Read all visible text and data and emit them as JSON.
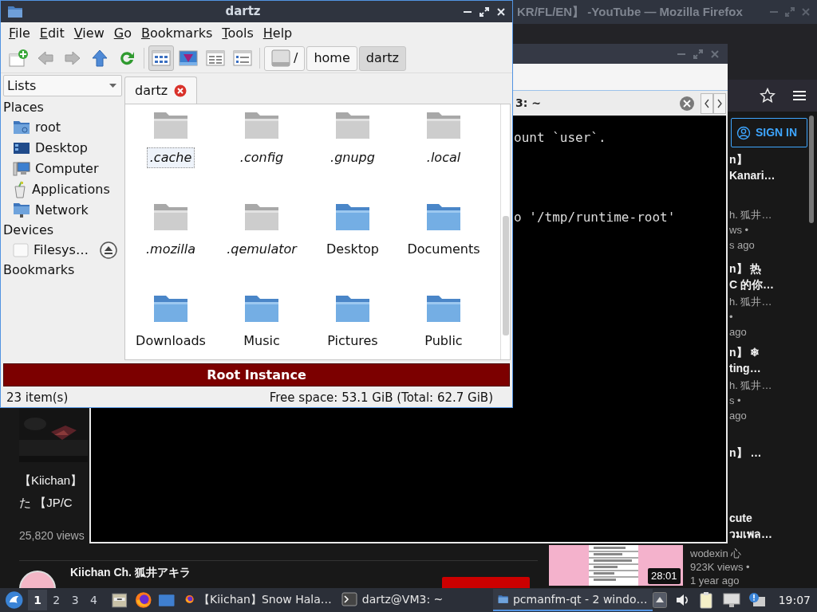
{
  "firefox": {
    "title": "KR/FL/EN】 -YouTube — Mozilla Firefox",
    "sign_in": "SIGN IN",
    "sidebar_videos": [
      {
        "title_lines": [
          "n】",
          "Kanari…"
        ],
        "meta_lines": [
          "h. 狐井…",
          "ws •",
          "s ago"
        ]
      },
      {
        "title_lines": [
          "n】 热",
          "C 的你…"
        ],
        "meta_lines": [
          "h. 狐井…",
          "•",
          "ago"
        ]
      },
      {
        "title_lines": [
          "n】 ❄",
          "ting…"
        ],
        "meta_lines": [
          "h. 狐井…",
          "s •",
          "ago"
        ]
      },
      {
        "title_lines": [
          "n】 …"
        ]
      },
      {
        "title_lines": [
          "cute",
          "วมเพล…"
        ]
      }
    ],
    "main_video": {
      "title_lines": [
        "【Kiichan】",
        "た 【JP/C"
      ],
      "views": "25,820 views",
      "channel": "Kiichan Ch. 狐井アキラ"
    },
    "side_video": {
      "duration": "28:01",
      "channel": "wodexin 心",
      "views": "923K views •",
      "age": "1 year ago"
    }
  },
  "terminal": {
    "tab_title": "3: ~",
    "lines": [
      "ount `user`.",
      "o '/tmp/runtime-root'"
    ]
  },
  "file_manager": {
    "title": "dartz",
    "menu": [
      "File",
      "Edit",
      "View",
      "Go",
      "Bookmarks",
      "Tools",
      "Help"
    ],
    "view_modes": [
      {
        "kind": "icons",
        "selected": true
      },
      {
        "kind": "thumbnails",
        "selected": false
      },
      {
        "kind": "compact",
        "selected": false
      },
      {
        "kind": "details",
        "selected": false
      }
    ],
    "path": [
      {
        "label": "/",
        "kind": "drive",
        "selected": false
      },
      {
        "label": "home",
        "selected": false
      },
      {
        "label": "dartz",
        "selected": true
      }
    ],
    "side_combo": "Lists",
    "sections": [
      {
        "title": "Places",
        "items": [
          {
            "label": "root",
            "kind": "home"
          },
          {
            "label": "Desktop",
            "kind": "desktop"
          },
          {
            "label": "Computer",
            "kind": "computer"
          },
          {
            "label": "Applications",
            "kind": "applications"
          },
          {
            "label": "Network",
            "kind": "network"
          }
        ]
      },
      {
        "title": "Devices",
        "items": [
          {
            "label": "Filesys…",
            "kind": "drive",
            "eject": true
          }
        ]
      },
      {
        "title": "Bookmarks"
      }
    ],
    "tab": "dartz",
    "files": [
      {
        "name": ".cache",
        "hidden": true,
        "selected": true
      },
      {
        "name": ".config",
        "hidden": true,
        "selected": false
      },
      {
        "name": ".gnupg",
        "hidden": true,
        "selected": false
      },
      {
        "name": ".local",
        "hidden": true,
        "selected": false
      },
      {
        "name": ".mozilla",
        "hidden": true,
        "selected": false
      },
      {
        "name": ".qemulator",
        "hidden": true,
        "selected": false
      },
      {
        "name": "Desktop",
        "hidden": false,
        "selected": false
      },
      {
        "name": "Documents",
        "hidden": false,
        "selected": false
      },
      {
        "name": "Downloads",
        "hidden": false,
        "selected": false
      },
      {
        "name": "Music",
        "hidden": false,
        "selected": false
      },
      {
        "name": "Pictures",
        "hidden": false,
        "selected": false
      },
      {
        "name": "Public",
        "hidden": false,
        "selected": false
      }
    ],
    "banner": "Root Instance",
    "status_left": "23 item(s)",
    "status_right": "Free space: 53.1 GiB (Total: 62.7 GiB)"
  },
  "taskbar": {
    "workspaces": [
      {
        "label": "1",
        "selected": true
      },
      {
        "label": "2",
        "selected": false
      },
      {
        "label": "3",
        "selected": false
      },
      {
        "label": "4",
        "selected": false
      }
    ],
    "tasks": [
      {
        "kind": "browser",
        "label": "【Kiichan】Snow Hala…",
        "selected": false
      },
      {
        "kind": "terminal",
        "label": "dartz@VM3: ~",
        "selected": false
      },
      {
        "kind": "files",
        "label": "pcmanfm-qt - 2 windo…",
        "selected": true
      }
    ],
    "clock": "19:07"
  }
}
